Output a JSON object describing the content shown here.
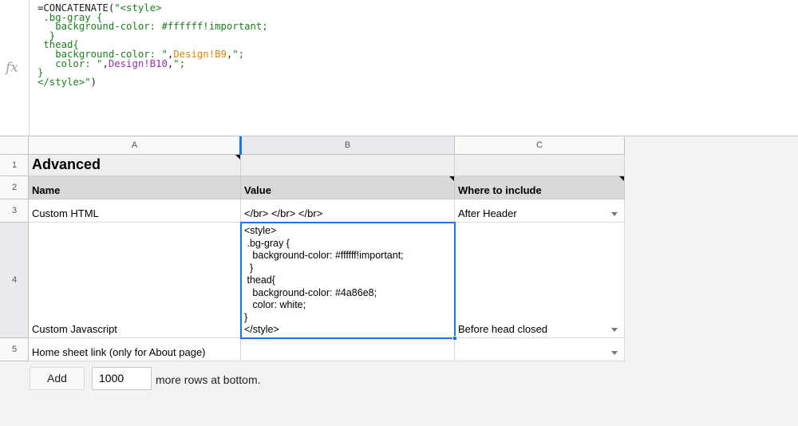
{
  "formula_bar": {
    "fx_label": "fx",
    "lines": [
      {
        "parts": [
          {
            "t": "=CONCATENATE(",
            "c": "fn"
          },
          {
            "t": "\"<style>",
            "c": "str"
          }
        ]
      },
      {
        "parts": [
          {
            "t": " .bg-gray {",
            "c": "str"
          }
        ]
      },
      {
        "parts": [
          {
            "t": "   background-color: #ffffff!important;",
            "c": "str"
          }
        ]
      },
      {
        "parts": [
          {
            "t": "  }",
            "c": "str"
          }
        ]
      },
      {
        "parts": [
          {
            "t": " thead{",
            "c": "str"
          }
        ]
      },
      {
        "parts": [
          {
            "t": "   background-color: \"",
            "c": "str"
          },
          {
            "t": ",",
            "c": "blk"
          },
          {
            "t": "Design!B9",
            "c": "ref-o"
          },
          {
            "t": ",",
            "c": "blk"
          },
          {
            "t": "\";",
            "c": "str"
          }
        ]
      },
      {
        "parts": [
          {
            "t": "   color: \"",
            "c": "str"
          },
          {
            "t": ",",
            "c": "blk"
          },
          {
            "t": "Design!B10",
            "c": "ref-p"
          },
          {
            "t": ",",
            "c": "blk"
          },
          {
            "t": "\";",
            "c": "str"
          }
        ]
      },
      {
        "parts": [
          {
            "t": "}",
            "c": "str"
          }
        ]
      },
      {
        "parts": [
          {
            "t": "</style>\"",
            "c": "str"
          },
          {
            "t": ")",
            "c": "fn"
          }
        ]
      }
    ]
  },
  "columns": [
    "A",
    "B",
    "C"
  ],
  "rows": [
    "1",
    "2",
    "3",
    "4",
    "5"
  ],
  "cells": {
    "a1": "Advanced",
    "a2": "Name",
    "b2": "Value",
    "c2": "Where to include",
    "a3": "Custom HTML",
    "b3": "</br> </br> </br>",
    "c3": "After Header",
    "a4": "Custom Javascript",
    "b4": "<style>\n .bg-gray {\n   background-color: #ffffff!important;\n  }\n thead{\n   background-color: #4a86e8;\n   color: white;\n}\n</style>",
    "c4": "Before head closed",
    "a5": "Home sheet link (only for About page)"
  },
  "footer": {
    "add_label": "Add",
    "rows_value": "1000",
    "rows_text": "more rows at bottom."
  },
  "colors": {
    "selection": "#1a73e8",
    "header_gray": "#d9d9d9",
    "formula_string": "#1d7d1d",
    "ref_orange": "#d58512",
    "ref_purple": "#9333a8"
  }
}
